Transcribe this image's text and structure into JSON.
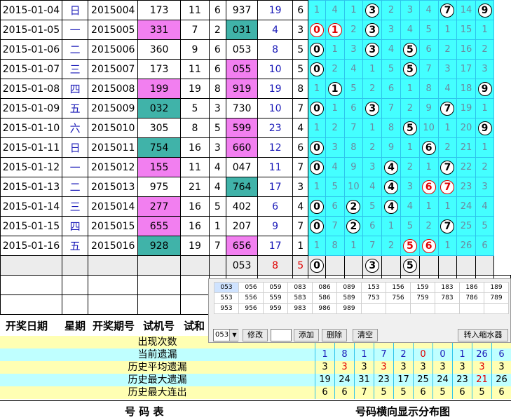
{
  "rows": [
    {
      "date": "2015-01-04",
      "weekday": "日",
      "issue": "2015004",
      "test": "173",
      "test_bg": "",
      "sum": "11",
      "span": "6",
      "draw": "937",
      "draw_bg": "",
      "d_sum": "19",
      "d_span": "6",
      "dist": [
        [
          1,
          0
        ],
        [
          4,
          0
        ],
        [
          1,
          0
        ],
        [
          3,
          1
        ],
        [
          2,
          0
        ],
        [
          3,
          0
        ],
        [
          4,
          0
        ],
        [
          7,
          1
        ],
        [
          14,
          0
        ],
        [
          9,
          1
        ]
      ]
    },
    {
      "date": "2015-01-05",
      "weekday": "一",
      "issue": "2015005",
      "test": "331",
      "test_bg": "pink",
      "sum": "7",
      "span": "2",
      "draw": "031",
      "draw_bg": "teal",
      "d_sum": "4",
      "d_span": "3",
      "dist": [
        [
          0,
          2
        ],
        [
          1,
          2
        ],
        [
          2,
          0
        ],
        [
          3,
          1
        ],
        [
          3,
          0
        ],
        [
          4,
          0
        ],
        [
          5,
          0
        ],
        [
          1,
          0
        ],
        [
          15,
          0
        ],
        [
          1,
          0
        ]
      ]
    },
    {
      "date": "2015-01-06",
      "weekday": "二",
      "issue": "2015006",
      "test": "360",
      "test_bg": "",
      "sum": "9",
      "span": "6",
      "draw": "053",
      "draw_bg": "",
      "d_sum": "8",
      "d_span": "5",
      "dist": [
        [
          0,
          1
        ],
        [
          1,
          0
        ],
        [
          3,
          0
        ],
        [
          3,
          1
        ],
        [
          4,
          0
        ],
        [
          5,
          1
        ],
        [
          6,
          0
        ],
        [
          2,
          0
        ],
        [
          16,
          0
        ],
        [
          2,
          0
        ]
      ]
    },
    {
      "date": "2015-01-07",
      "weekday": "三",
      "issue": "2015007",
      "test": "173",
      "test_bg": "",
      "sum": "11",
      "span": "6",
      "draw": "055",
      "draw_bg": "pink",
      "d_sum": "10",
      "d_span": "5",
      "dist": [
        [
          0,
          1
        ],
        [
          2,
          0
        ],
        [
          4,
          0
        ],
        [
          1,
          0
        ],
        [
          5,
          0
        ],
        [
          5,
          1
        ],
        [
          7,
          0
        ],
        [
          3,
          0
        ],
        [
          17,
          0
        ],
        [
          3,
          0
        ]
      ]
    },
    {
      "date": "2015-01-08",
      "weekday": "四",
      "issue": "2015008",
      "test": "199",
      "test_bg": "pink",
      "sum": "19",
      "span": "8",
      "draw": "919",
      "draw_bg": "pink",
      "d_sum": "19",
      "d_span": "8",
      "dist": [
        [
          1,
          0
        ],
        [
          1,
          1
        ],
        [
          5,
          0
        ],
        [
          2,
          0
        ],
        [
          6,
          0
        ],
        [
          1,
          0
        ],
        [
          8,
          0
        ],
        [
          4,
          0
        ],
        [
          18,
          0
        ],
        [
          9,
          1
        ]
      ]
    },
    {
      "date": "2015-01-09",
      "weekday": "五",
      "issue": "2015009",
      "test": "032",
      "test_bg": "teal",
      "sum": "5",
      "span": "3",
      "draw": "730",
      "draw_bg": "",
      "d_sum": "10",
      "d_span": "7",
      "dist": [
        [
          0,
          1
        ],
        [
          1,
          0
        ],
        [
          6,
          0
        ],
        [
          3,
          1
        ],
        [
          7,
          0
        ],
        [
          2,
          0
        ],
        [
          9,
          0
        ],
        [
          7,
          1
        ],
        [
          19,
          0
        ],
        [
          1,
          0
        ]
      ]
    },
    {
      "date": "2015-01-10",
      "weekday": "六",
      "issue": "2015010",
      "test": "305",
      "test_bg": "",
      "sum": "8",
      "span": "5",
      "draw": "599",
      "draw_bg": "pink",
      "d_sum": "23",
      "d_span": "4",
      "dist": [
        [
          1,
          0
        ],
        [
          2,
          0
        ],
        [
          7,
          0
        ],
        [
          1,
          0
        ],
        [
          8,
          0
        ],
        [
          5,
          1
        ],
        [
          10,
          0
        ],
        [
          1,
          0
        ],
        [
          20,
          0
        ],
        [
          9,
          1
        ]
      ]
    },
    {
      "date": "2015-01-11",
      "weekday": "日",
      "issue": "2015011",
      "test": "754",
      "test_bg": "teal",
      "sum": "16",
      "span": "3",
      "draw": "660",
      "draw_bg": "pink",
      "d_sum": "12",
      "d_span": "6",
      "dist": [
        [
          0,
          1
        ],
        [
          3,
          0
        ],
        [
          8,
          0
        ],
        [
          2,
          0
        ],
        [
          9,
          0
        ],
        [
          1,
          0
        ],
        [
          6,
          1
        ],
        [
          2,
          0
        ],
        [
          21,
          0
        ],
        [
          1,
          0
        ]
      ]
    },
    {
      "date": "2015-01-12",
      "weekday": "一",
      "issue": "2015012",
      "test": "155",
      "test_bg": "pink",
      "sum": "11",
      "span": "4",
      "draw": "047",
      "draw_bg": "",
      "d_sum": "11",
      "d_span": "7",
      "dist": [
        [
          0,
          1
        ],
        [
          4,
          0
        ],
        [
          9,
          0
        ],
        [
          3,
          0
        ],
        [
          4,
          1
        ],
        [
          2,
          0
        ],
        [
          1,
          0
        ],
        [
          7,
          1
        ],
        [
          22,
          0
        ],
        [
          2,
          0
        ]
      ]
    },
    {
      "date": "2015-01-13",
      "weekday": "二",
      "issue": "2015013",
      "test": "975",
      "test_bg": "",
      "sum": "21",
      "span": "4",
      "draw": "764",
      "draw_bg": "teal",
      "d_sum": "17",
      "d_span": "3",
      "dist": [
        [
          1,
          0
        ],
        [
          5,
          0
        ],
        [
          10,
          0
        ],
        [
          4,
          0
        ],
        [
          4,
          1
        ],
        [
          3,
          0
        ],
        [
          6,
          2
        ],
        [
          7,
          2
        ],
        [
          23,
          0
        ],
        [
          3,
          0
        ]
      ]
    },
    {
      "date": "2015-01-14",
      "weekday": "三",
      "issue": "2015014",
      "test": "277",
      "test_bg": "pink",
      "sum": "16",
      "span": "5",
      "draw": "402",
      "draw_bg": "",
      "d_sum": "6",
      "d_span": "4",
      "dist": [
        [
          0,
          1
        ],
        [
          6,
          0
        ],
        [
          2,
          1
        ],
        [
          5,
          0
        ],
        [
          4,
          1
        ],
        [
          4,
          0
        ],
        [
          1,
          0
        ],
        [
          1,
          0
        ],
        [
          24,
          0
        ],
        [
          4,
          0
        ]
      ]
    },
    {
      "date": "2015-01-15",
      "weekday": "四",
      "issue": "2015015",
      "test": "655",
      "test_bg": "pink",
      "sum": "16",
      "span": "1",
      "draw": "207",
      "draw_bg": "",
      "d_sum": "9",
      "d_span": "7",
      "dist": [
        [
          0,
          1
        ],
        [
          7,
          0
        ],
        [
          2,
          1
        ],
        [
          6,
          0
        ],
        [
          1,
          0
        ],
        [
          5,
          0
        ],
        [
          2,
          0
        ],
        [
          7,
          1
        ],
        [
          25,
          0
        ],
        [
          5,
          0
        ]
      ]
    },
    {
      "date": "2015-01-16",
      "weekday": "五",
      "issue": "2015016",
      "test": "928",
      "test_bg": "teal",
      "sum": "19",
      "span": "7",
      "draw": "656",
      "draw_bg": "pink",
      "d_sum": "17",
      "d_span": "1",
      "dist": [
        [
          1,
          0
        ],
        [
          8,
          0
        ],
        [
          1,
          0
        ],
        [
          7,
          0
        ],
        [
          2,
          0
        ],
        [
          5,
          2
        ],
        [
          6,
          2
        ],
        [
          1,
          0
        ],
        [
          26,
          0
        ],
        [
          6,
          0
        ]
      ]
    }
  ],
  "preview_row": {
    "draw": "053",
    "d_sum": "8",
    "d_span": "5",
    "balls": [
      "0",
      "",
      "",
      "3",
      "",
      "5",
      "",
      "",
      "",
      ""
    ]
  },
  "headers": {
    "date": "开奖日期",
    "weekday": "星期",
    "issue": "开奖期号",
    "test": "试机号",
    "extra": "试和"
  },
  "stats": [
    {
      "label": "出现次数",
      "values": [],
      "colors": []
    },
    {
      "label": "当前遗漏",
      "values": [
        "1",
        "8",
        "1",
        "7",
        "2",
        "0",
        "0",
        "1",
        "26",
        "6"
      ],
      "colors": [
        "blue",
        "blue",
        "blue",
        "blue",
        "blue",
        "red",
        "blue",
        "blue",
        "blue",
        "blue"
      ]
    },
    {
      "label": "历史平均遗漏",
      "values": [
        "3",
        "3",
        "3",
        "3",
        "3",
        "3",
        "3",
        "3",
        "3",
        "3"
      ],
      "colors": [
        "k",
        "red",
        "k",
        "red",
        "k",
        "k",
        "k",
        "k",
        "red",
        "k"
      ]
    },
    {
      "label": "历史最大遗漏",
      "values": [
        "19",
        "24",
        "31",
        "23",
        "17",
        "25",
        "24",
        "23",
        "21",
        "26"
      ],
      "colors": [
        "k",
        "k",
        "k",
        "k",
        "k",
        "k",
        "k",
        "k",
        "red",
        "k"
      ]
    },
    {
      "label": "历史最大连出",
      "values": [
        "6",
        "6",
        "7",
        "5",
        "5",
        "6",
        "5",
        "6",
        "5",
        "6"
      ],
      "colors": [
        "k",
        "k",
        "k",
        "k",
        "k",
        "k",
        "k",
        "k",
        "k",
        "k"
      ]
    }
  ],
  "footer": {
    "left": "号  码  表",
    "right": "号码横向显示分布图"
  },
  "panel": {
    "numbers": [
      [
        "053",
        "056",
        "059",
        "083",
        "086",
        "089",
        "153",
        "156",
        "159",
        "183",
        "186",
        "189"
      ],
      [
        "553",
        "556",
        "559",
        "583",
        "586",
        "589",
        "753",
        "756",
        "759",
        "783",
        "786",
        "789"
      ],
      [
        "953",
        "956",
        "959",
        "983",
        "986",
        "989",
        "",
        "",
        "",
        "",
        "",
        ""
      ]
    ],
    "select_value": "053",
    "btn_modify": "修改",
    "btn_add": "添加",
    "btn_delete": "删除",
    "btn_clear": "清空",
    "btn_import": "转入缩水器"
  }
}
